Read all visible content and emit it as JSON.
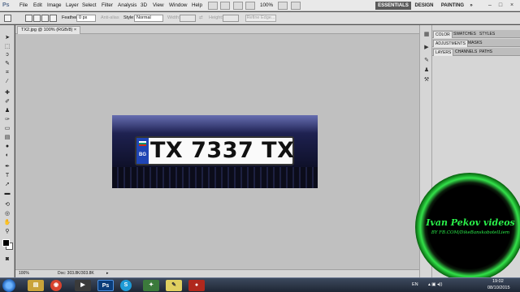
{
  "app": {
    "logo": "Ps"
  },
  "menu": [
    "File",
    "Edit",
    "Image",
    "Layer",
    "Select",
    "Filter",
    "Analysis",
    "3D",
    "View",
    "Window",
    "Help"
  ],
  "menubar_right": {
    "zoom": "100%",
    "workspaces": [
      "ESSENTIALS",
      "DESIGN",
      "PAINTING",
      "»"
    ]
  },
  "options": {
    "feather_label": "Feather:",
    "feather_value": "0 px",
    "antialias_label": "Anti-alias",
    "style_label": "Style:",
    "style_value": "Normal",
    "width_label": "Width:",
    "height_label": "Height:",
    "refine_edge": "Refine Edge..."
  },
  "document": {
    "tab_title": "TX2.jpg @ 100% (RGB/8)",
    "plate_country": "BG",
    "plate_number": "TX 7337 TX",
    "status_zoom": "100%",
    "status_doc": "Doc: 303.8K/303.8K"
  },
  "panels": {
    "group1": [
      "COLOR",
      "SWATCHES",
      "STYLES"
    ],
    "group2": [
      "ADJUSTMENTS",
      "MASKS"
    ],
    "group3": [
      "LAYERS",
      "CHANNELS",
      "PATHS"
    ]
  },
  "watermark": {
    "line1": "Ivan Pekov videos",
    "line2": "BY FB.COM/DikeBanskobotelLiem"
  },
  "taskbar": {
    "lang": "EN",
    "time": "19:02",
    "date": "08/10/2015"
  },
  "colors": {
    "accent_green": "#2af04a",
    "ps_blue": "#1f45b4"
  }
}
